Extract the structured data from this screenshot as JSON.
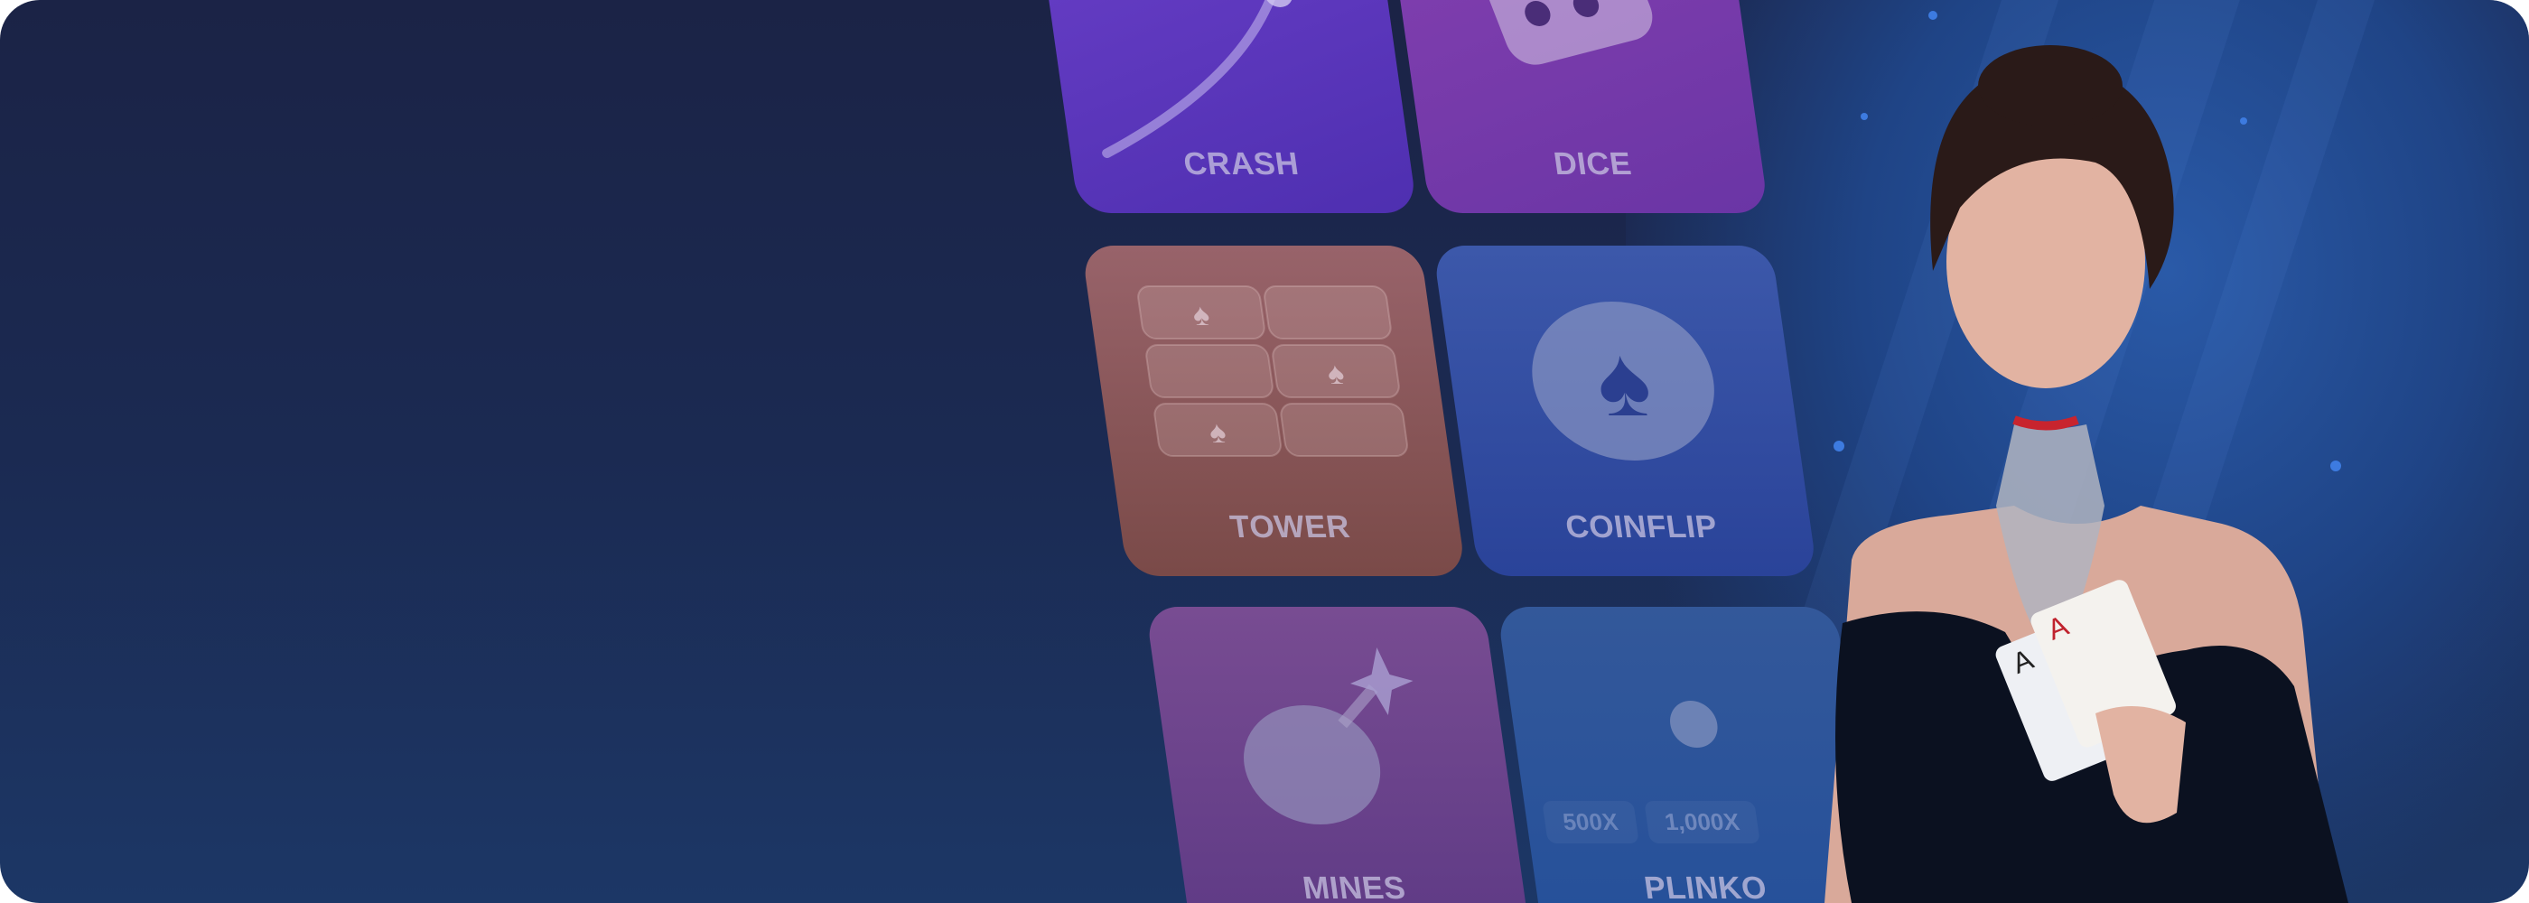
{
  "tiles": {
    "crash": {
      "label": "CRASH",
      "color": "#5b36bb"
    },
    "dice": {
      "label": "DICE",
      "color": "#7a38aa"
    },
    "tower": {
      "label": "TOWER",
      "color": "#8c5860"
    },
    "coinflip": {
      "label": "COINFLIP",
      "color": "#2e4aa0"
    },
    "mines": {
      "label": "MINES",
      "color": "#6c4592"
    },
    "plinko": {
      "label": "PLINKO",
      "color": "#2a5298",
      "multipliers": [
        "500X",
        "1,000X"
      ]
    }
  },
  "colors": {
    "background_top": "#1b2346",
    "background_bottom": "#1c3766",
    "accent_blue": "#2a5aa8"
  }
}
